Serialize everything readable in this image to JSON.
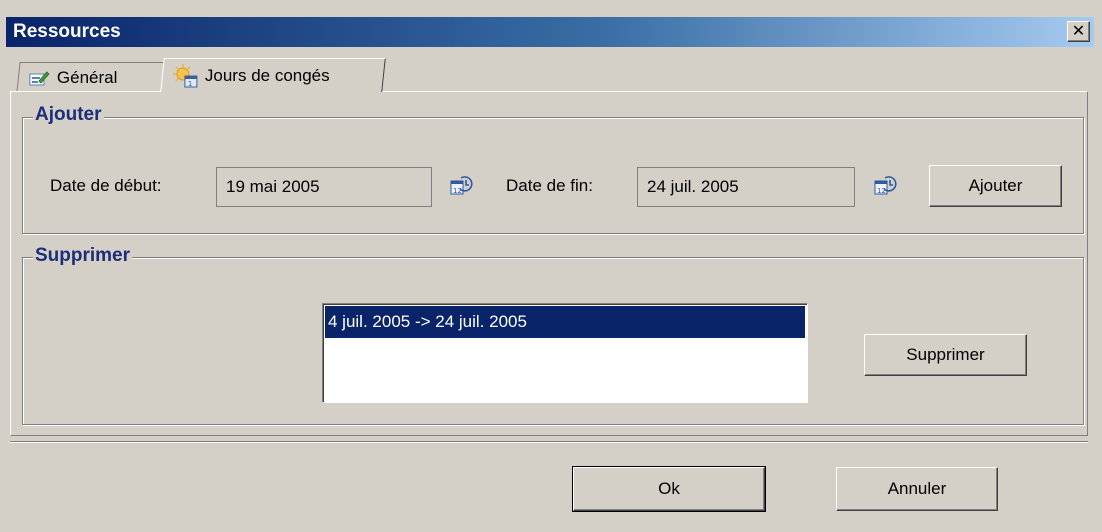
{
  "window": {
    "title": "Ressources"
  },
  "tabs": [
    {
      "label": "Général",
      "icon": "edit-icon"
    },
    {
      "label": "Jours de congés",
      "icon": "calendar-sun-icon"
    }
  ],
  "add_group": {
    "title": "Ajouter",
    "start_label": "Date de début:",
    "start_value": "19 mai 2005",
    "end_label": "Date de fin:",
    "end_value": "24 juil. 2005",
    "add_button": "Ajouter"
  },
  "remove_group": {
    "title": "Supprimer",
    "items": [
      "4 juil. 2005 -> 24 juil. 2005"
    ],
    "remove_button": "Supprimer"
  },
  "footer": {
    "ok": "Ok",
    "cancel": "Annuler"
  },
  "colors": {
    "face": "#d4d0c8",
    "selection": "#0a246a",
    "group_title": "#1c2e78"
  }
}
